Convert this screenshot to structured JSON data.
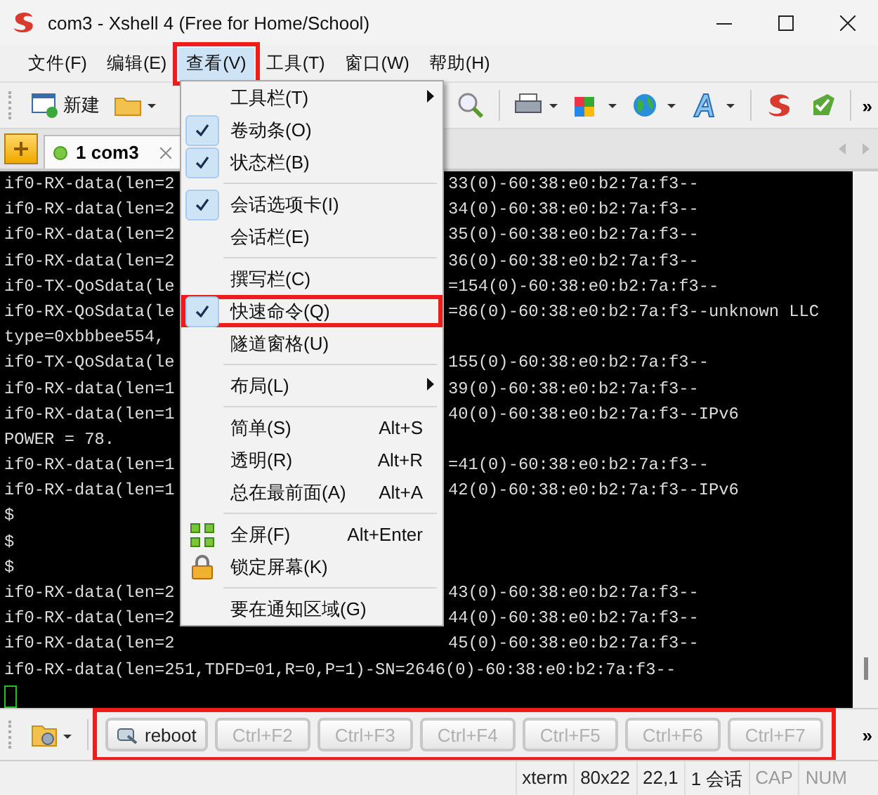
{
  "window": {
    "title": "com3 - Xshell 4 (Free for Home/School)"
  },
  "menubar": [
    {
      "label": "文件(F)",
      "selected": false,
      "highlighted": false
    },
    {
      "label": "编辑(E)",
      "selected": false,
      "highlighted": false
    },
    {
      "label": "查看(V)",
      "selected": true,
      "highlighted": true
    },
    {
      "label": "工具(T)",
      "selected": false,
      "highlighted": false
    },
    {
      "label": "窗口(W)",
      "selected": false,
      "highlighted": false
    },
    {
      "label": "帮助(H)",
      "selected": false,
      "highlighted": false
    }
  ],
  "toolbar": {
    "new_label": "新建",
    "more": "»"
  },
  "tabs": [
    {
      "number": "1",
      "label": "com3",
      "selected": true
    }
  ],
  "view_menu": [
    {
      "kind": "item",
      "label": "工具栏(T)",
      "checked": false,
      "submenu": true,
      "highlighted": false
    },
    {
      "kind": "item",
      "label": "卷动条(O)",
      "checked": true,
      "submenu": false,
      "highlighted": false
    },
    {
      "kind": "item",
      "label": "状态栏(B)",
      "checked": true,
      "submenu": false,
      "highlighted": false
    },
    {
      "kind": "separator"
    },
    {
      "kind": "item",
      "label": "会话选项卡(I)",
      "checked": true,
      "submenu": false,
      "highlighted": false
    },
    {
      "kind": "item",
      "label": "会话栏(E)",
      "checked": false,
      "submenu": false,
      "highlighted": false
    },
    {
      "kind": "separator"
    },
    {
      "kind": "item",
      "label": "撰写栏(C)",
      "checked": false,
      "submenu": false,
      "highlighted": false
    },
    {
      "kind": "item",
      "label": "快速命令(Q)",
      "checked": true,
      "submenu": false,
      "highlighted": true
    },
    {
      "kind": "item",
      "label": "隧道窗格(U)",
      "checked": false,
      "submenu": false,
      "highlighted": false
    },
    {
      "kind": "separator"
    },
    {
      "kind": "item",
      "label": "布局(L)",
      "checked": false,
      "submenu": true,
      "highlighted": false
    },
    {
      "kind": "separator"
    },
    {
      "kind": "item",
      "label": "简单(S)",
      "checked": false,
      "submenu": false,
      "highlighted": false,
      "shortcut": "Alt+S"
    },
    {
      "kind": "item",
      "label": "透明(R)",
      "checked": false,
      "submenu": false,
      "highlighted": false,
      "shortcut": "Alt+R"
    },
    {
      "kind": "item",
      "label": "总在最前面(A)",
      "checked": false,
      "submenu": false,
      "highlighted": false,
      "shortcut": "Alt+A"
    },
    {
      "kind": "separator"
    },
    {
      "kind": "fullscreen",
      "label": "全屏(F)",
      "checked": false,
      "submenu": false,
      "highlighted": false,
      "shortcut": "Alt+Enter"
    },
    {
      "kind": "lock",
      "label": "锁定屏幕(K)",
      "checked": false,
      "submenu": false,
      "highlighted": false
    },
    {
      "kind": "separator"
    },
    {
      "kind": "item",
      "label": "要在通知区域(G)",
      "checked": false,
      "submenu": false,
      "highlighted": false
    }
  ],
  "terminal": [
    {
      "kind": "split",
      "left": "if0-RX-data(len=2",
      "right": "33(0)-60:38:e0:b2:7a:f3--"
    },
    {
      "kind": "split",
      "left": "if0-RX-data(len=2",
      "right": "34(0)-60:38:e0:b2:7a:f3--"
    },
    {
      "kind": "split",
      "left": "if0-RX-data(len=2",
      "right": "35(0)-60:38:e0:b2:7a:f3--"
    },
    {
      "kind": "split",
      "left": "if0-RX-data(len=2",
      "right": "36(0)-60:38:e0:b2:7a:f3--"
    },
    {
      "kind": "split",
      "left": "if0-TX-QoSdata(le",
      "right": "=154(0)-60:38:e0:b2:7a:f3--"
    },
    {
      "kind": "split",
      "left": "if0-RX-QoSdata(le",
      "right": "=86(0)-60:38:e0:b2:7a:f3--unknown LLC"
    },
    {
      "kind": "split",
      "left": "type=0xbbbee554,"
    },
    {
      "kind": "split",
      "left": "if0-TX-QoSdata(le",
      "right": "155(0)-60:38:e0:b2:7a:f3--"
    },
    {
      "kind": "split",
      "left": "if0-RX-data(len=1",
      "right": "39(0)-60:38:e0:b2:7a:f3--"
    },
    {
      "kind": "split",
      "left": "if0-RX-data(len=1",
      "right": "40(0)-60:38:e0:b2:7a:f3--IPv6"
    },
    {
      "kind": "split",
      "left": "POWER = 78."
    },
    {
      "kind": "split",
      "left": "if0-RX-data(len=1",
      "right": "=41(0)-60:38:e0:b2:7a:f3--"
    },
    {
      "kind": "split",
      "left": "if0-RX-data(len=1",
      "right": "42(0)-60:38:e0:b2:7a:f3--IPv6"
    },
    {
      "kind": "split",
      "left": "$"
    },
    {
      "kind": "split",
      "left": "$"
    },
    {
      "kind": "split",
      "left": "$"
    },
    {
      "kind": "split",
      "left": "if0-RX-data(len=2",
      "right": "43(0)-60:38:e0:b2:7a:f3--"
    },
    {
      "kind": "split",
      "left": "if0-RX-data(len=2",
      "right": "44(0)-60:38:e0:b2:7a:f3--"
    },
    {
      "kind": "split",
      "left": "if0-RX-data(len=2",
      "right": "45(0)-60:38:e0:b2:7a:f3--"
    },
    {
      "kind": "full",
      "left": "if0-RX-data(len=251,TDFD=01,R=0,P=1)-SN=2646(0)-60:38:e0:b2:7a:f3--"
    },
    {
      "kind": "cursor"
    }
  ],
  "quick_bar": {
    "highlighted": true,
    "more": "»",
    "commands": [
      {
        "label": "reboot",
        "disabled": false
      },
      {
        "label": "Ctrl+F2",
        "disabled": true
      },
      {
        "label": "Ctrl+F3",
        "disabled": true
      },
      {
        "label": "Ctrl+F4",
        "disabled": true
      },
      {
        "label": "Ctrl+F5",
        "disabled": true
      },
      {
        "label": "Ctrl+F6",
        "disabled": true
      },
      {
        "label": "Ctrl+F7",
        "disabled": true
      }
    ]
  },
  "status_bar": [
    {
      "text": "xterm",
      "disabled": false
    },
    {
      "text": "80x22",
      "disabled": false
    },
    {
      "text": "22,1",
      "disabled": false
    },
    {
      "text": "1 会话",
      "disabled": false
    },
    {
      "text": "CAP",
      "disabled": true
    },
    {
      "text": "NUM",
      "disabled": true
    }
  ]
}
